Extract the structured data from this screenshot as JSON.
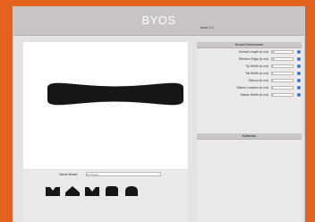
{
  "app": {
    "title": "BYOS",
    "version": "beta 1.0"
  },
  "design": {
    "name_label": "Name Board:",
    "name_placeholder": "My Board",
    "shapes": [
      "twin-tip-shape-icon",
      "directional-shape-icon",
      "swallowtail-shape-icon",
      "rounded-shape-icon",
      "pintail-shape-icon"
    ]
  },
  "panel1": {
    "title": "Board Dimensions",
    "rows": [
      {
        "label": "Overall Length (in cm)",
        "value": "15"
      },
      {
        "label": "Effective Edge (in cm)",
        "value": "15"
      },
      {
        "label": "Tip Width (in cm)",
        "value": "5"
      },
      {
        "label": "Tail Width (in cm)",
        "value": "5"
      },
      {
        "label": "Sidecut (in cm)",
        "value": "5"
      },
      {
        "label": "Stance Location (in cm)",
        "value": "5"
      },
      {
        "label": "Stance Width (in cm)",
        "value": "5"
      }
    ]
  },
  "panel2": {
    "title": "Materials"
  },
  "colors": {
    "background": "#e4621c",
    "panel": "#e5e2e2",
    "board": "#161616",
    "info_icon": "#3a7ad8"
  }
}
